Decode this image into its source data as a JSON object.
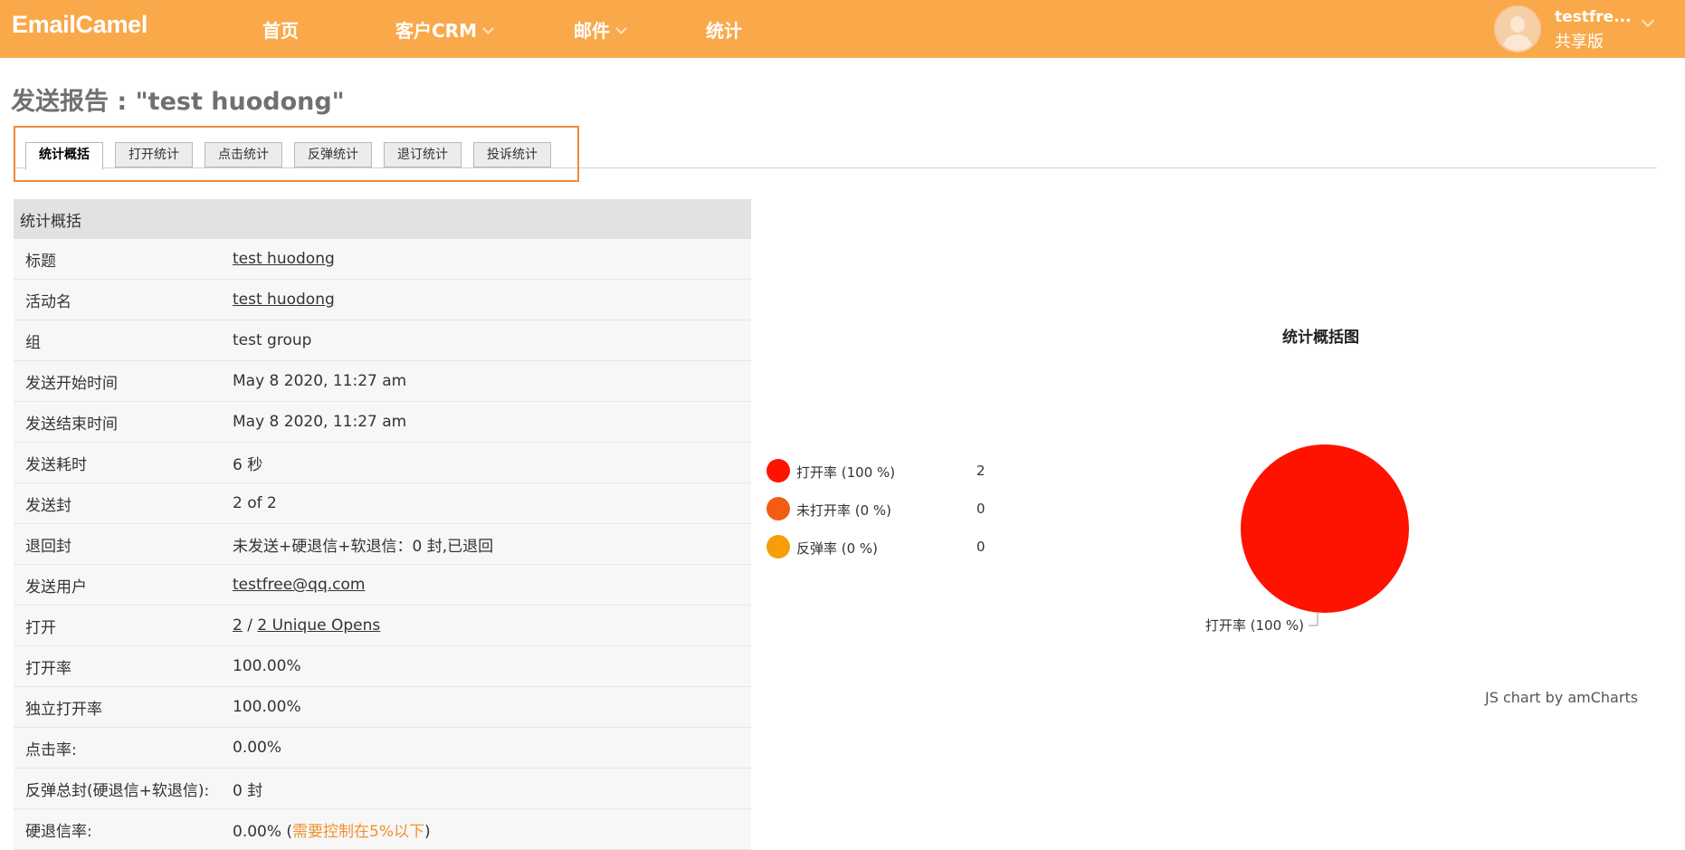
{
  "app": {
    "logo": "EmailCamel"
  },
  "nav": {
    "home": "首页",
    "crm": "客户CRM",
    "mail": "邮件",
    "stats": "统计"
  },
  "user": {
    "name": "testfre...",
    "plan": "共享版"
  },
  "page": {
    "title": "发送报告 : \"test huodong\""
  },
  "tabs": [
    "统计概括",
    "打开统计",
    "点击统计",
    "反弹统计",
    "退订统计",
    "投诉统计"
  ],
  "table": {
    "header": "统计概括",
    "rows": [
      {
        "label": "标题",
        "value": "test huodong"
      },
      {
        "label": "活动名",
        "value": "test huodong"
      },
      {
        "label": "组",
        "value": "test group"
      },
      {
        "label": "发送开始时间",
        "value": "May 8 2020, 11:27 am"
      },
      {
        "label": "发送结束时间",
        "value": "May 8 2020, 11:27 am"
      },
      {
        "label": "发送耗时",
        "value": "6 秒"
      },
      {
        "label": "发送封",
        "value": "2 of 2"
      },
      {
        "label": "退回封",
        "value": "未发送+硬退信+软退信：0 封,已退回"
      },
      {
        "label": "发送用户",
        "value": "testfree@qq.com"
      },
      {
        "label": "打开",
        "value_a": "2",
        "sep": " / ",
        "value_b": "2 Unique Opens"
      },
      {
        "label": "打开率",
        "value": "100.00%"
      },
      {
        "label": "独立打开率",
        "value": "100.00%"
      },
      {
        "label": "点击率:",
        "value": "0.00%"
      },
      {
        "label": "反弹总封(硬退信+软退信):",
        "value": "0 封"
      },
      {
        "label": "硬退信率:",
        "value": "0.00% (",
        "note": "需要控制在5%以下",
        "value_end": ")"
      }
    ]
  },
  "chart_data": {
    "type": "pie",
    "title": "统计概括图",
    "slices": [
      {
        "label": "打开率 (100 %)",
        "value": 2,
        "color": "#ff1200"
      },
      {
        "label": "未打开率 (0 %)",
        "value": 0,
        "color": "#f25c13"
      },
      {
        "label": "反弹率 (0 %)",
        "value": 0,
        "color": "#f79d07"
      }
    ],
    "slice_label": "打开率 (100 %)",
    "credit": "JS chart by amCharts"
  }
}
